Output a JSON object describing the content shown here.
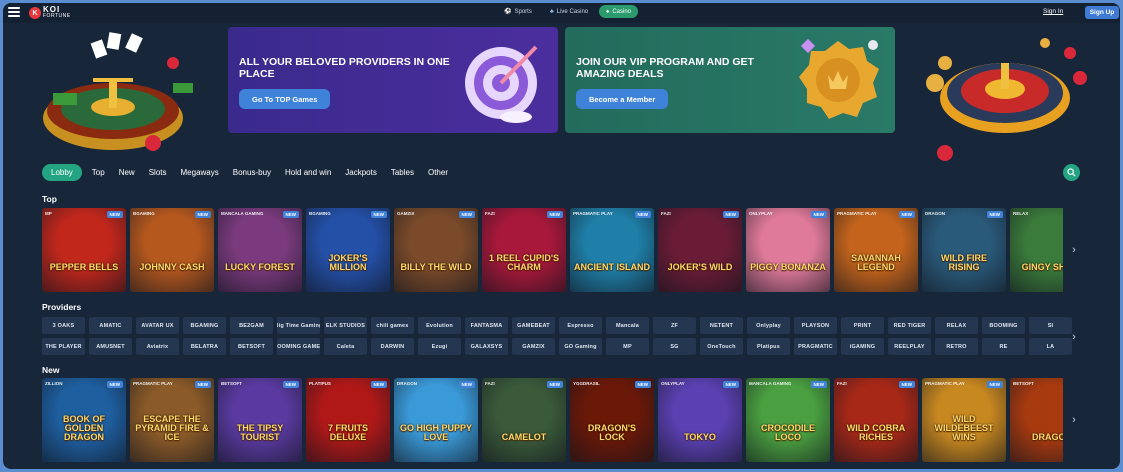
{
  "header": {
    "tabs": [
      {
        "label": "Sports",
        "icon": "sports-icon"
      },
      {
        "label": "Live Casino",
        "icon": "live-casino-icon"
      },
      {
        "label": "Casino",
        "icon": "casino-icon",
        "active": true
      }
    ],
    "sign_in": "Sign In",
    "sign_up": "Sign Up",
    "logo_top": "KOI",
    "logo_bottom": "FORTUNE"
  },
  "promos": [
    {
      "title": "ALL YOUR BELOVED PROVIDERS IN ONE PLACE",
      "button": "Go To TOP Games",
      "color": "#3d2b91"
    },
    {
      "title": "JOIN OUR VIP PROGRAM AND GET AMAZING DEALS",
      "button": "Become a Member",
      "color": "#26715f"
    }
  ],
  "categories": [
    "Lobby",
    "Top",
    "New",
    "Slots",
    "Megaways",
    "Bonus-buy",
    "Hold and win",
    "Jackpots",
    "Tables",
    "Other"
  ],
  "sections": {
    "top": "Top",
    "providers": "Providers",
    "new": "New"
  },
  "top_games": [
    {
      "name": "Pepper Bells",
      "provider": "MP",
      "bg": "#c2271c"
    },
    {
      "name": "Johnny Cash",
      "provider": "BGaming",
      "bg": "#b5581e"
    },
    {
      "name": "Lucky Forest",
      "provider": "Mancala Gaming",
      "bg": "#7a3a7d"
    },
    {
      "name": "Joker's Million",
      "provider": "BGaming",
      "bg": "#2450a8"
    },
    {
      "name": "Billy the Wild",
      "provider": "Gamzix",
      "bg": "#7a4a2a"
    },
    {
      "name": "1 Reel Cupid's Charm",
      "provider": "Fazi",
      "bg": "#a8183a"
    },
    {
      "name": "Ancient Island",
      "provider": "Pragmatic Play",
      "bg": "#1f7fa8"
    },
    {
      "name": "Joker's Wild",
      "provider": "Fazi",
      "bg": "#6a1c36"
    },
    {
      "name": "Piggy Bonanza",
      "provider": "Onlyplay",
      "bg": "#e07a9a"
    },
    {
      "name": "Savannah Legend",
      "provider": "Pragmatic Play",
      "bg": "#c4641c"
    },
    {
      "name": "Wild Fire Rising",
      "provider": "Dragon",
      "bg": "#2a5a7a"
    },
    {
      "name": "Gingy Shell",
      "provider": "Relax",
      "bg": "#3a7a3a"
    }
  ],
  "providers_row1": [
    "3 OAKS",
    "AMATIC",
    "AVATAR UX",
    "BGAMING",
    "BE2GAM",
    "Big Time Gaming",
    "ELK STUDIOS",
    "chili games",
    "Evolution",
    "FANTASMA",
    "GAMEBEAT",
    "Espresso",
    "Mancala",
    "ZF",
    "NETENT",
    "Onlyplay",
    "PLAYSON",
    "PRINT",
    "RED TIGER",
    "RELAX",
    "BOOMING",
    "SI"
  ],
  "providers_row2": [
    "THE PLAYER",
    "AMUSNET",
    "Aviatrix",
    "BELATRA",
    "BETSOFT",
    "BOOMING GAMES",
    "Caleta",
    "DARWIN",
    "Ezugi",
    "GALAXSYS",
    "GAMZIX",
    "GO Gaming",
    "MP",
    "SG",
    "OneTouch",
    "Platipus",
    "PRAGMATIC",
    "iGAMING",
    "REELPLAY",
    "RETRO",
    "RE",
    "LA"
  ],
  "new_games": [
    {
      "name": "Book of Golden Dragon",
      "provider": "Zillion",
      "bg": "#1e5fa0"
    },
    {
      "name": "Escape the Pyramid Fire & Ice",
      "provider": "Pragmatic Play",
      "bg": "#8a5a28"
    },
    {
      "name": "The Tipsy Tourist",
      "provider": "Betsoft",
      "bg": "#5a3aa0"
    },
    {
      "name": "7 Fruits Deluxe",
      "provider": "Platipus",
      "bg": "#b01818"
    },
    {
      "name": "Go High Puppy Love",
      "provider": "Dragon",
      "bg": "#3a9ad8"
    },
    {
      "name": "Camelot",
      "provider": "Fazi",
      "bg": "#3a5a3a"
    },
    {
      "name": "Dragon's Lock",
      "provider": "Yggdrasil",
      "bg": "#6a1808"
    },
    {
      "name": "Tokyo",
      "provider": "Onlyplay",
      "bg": "#5a40b0"
    },
    {
      "name": "Crocodile Loco",
      "provider": "Mancala Gaming",
      "bg": "#4aa040"
    },
    {
      "name": "Wild Cobra Riches",
      "provider": "Fazi",
      "bg": "#a82818"
    },
    {
      "name": "Wild Wildebeest Wins",
      "provider": "Pragmatic Play",
      "bg": "#c88820"
    },
    {
      "name": "Dragon",
      "provider": "Betsoft",
      "bg": "#a83a10"
    }
  ],
  "badge": "NEW",
  "colors": {
    "accent": "#24a582",
    "button": "#3f82d9",
    "background": "#18263a"
  }
}
